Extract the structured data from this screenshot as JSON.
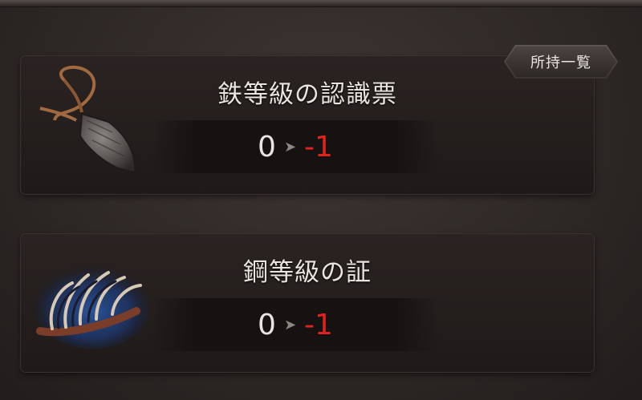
{
  "owned_list_button": "所持一覧",
  "items": [
    {
      "name": "鉄等級の認識票",
      "from": "0",
      "to": "-1",
      "icon": "iron-tag-icon"
    },
    {
      "name": "鋼等級の証",
      "from": "0",
      "to": "-1",
      "icon": "bone-claw-icon"
    }
  ],
  "colors": {
    "decrease": "#e2231d",
    "text": "#e9e4de"
  }
}
